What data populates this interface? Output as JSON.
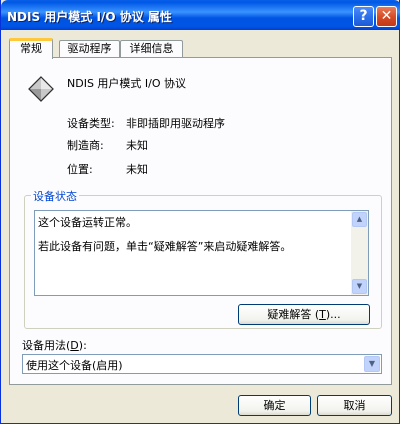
{
  "window": {
    "title": "NDIS 用户模式 I/O 协议 属性",
    "help_glyph": "?",
    "close_glyph": "✕"
  },
  "tabs": [
    {
      "label": "常规",
      "active": true
    },
    {
      "label": "驱动程序",
      "active": false
    },
    {
      "label": "详细信息",
      "active": false
    }
  ],
  "device": {
    "icon": "network-protocol-icon",
    "name": "NDIS 用户模式 I/O 协议"
  },
  "properties": [
    {
      "label": "设备类型:",
      "value": "非即插即用驱动程序"
    },
    {
      "label": "制造商:",
      "value": "未知"
    },
    {
      "label": "位置:",
      "value": "未知"
    }
  ],
  "status": {
    "legend": "设备状态",
    "lines": [
      "这个设备运转正常。",
      "若此设备有问题，单击“疑难解答”来启动疑难解答。"
    ],
    "troubleshoot_button": {
      "label": "疑难解答",
      "accel": "T",
      "suffix": "..."
    }
  },
  "usage": {
    "label": "设备用法",
    "accel": "D",
    "selected": "使用这个设备(启用)"
  },
  "buttons": {
    "ok": "确定",
    "cancel": "取消"
  }
}
